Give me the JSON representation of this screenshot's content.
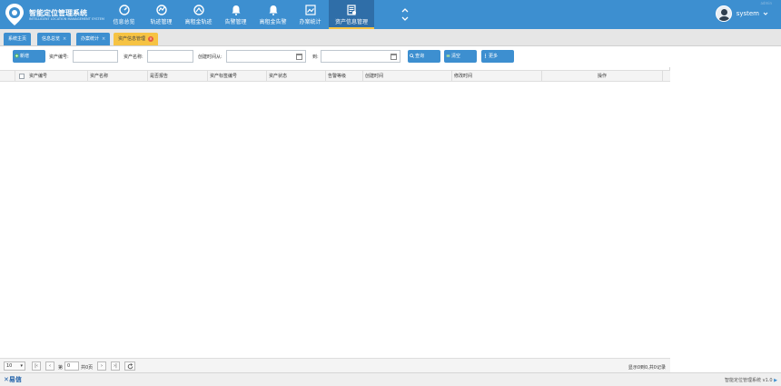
{
  "header": {
    "brand": "智能定位管理系统",
    "brand_sub": "INTELLIGENT LOCATION MANAGEMENT SYSTEM",
    "watermark": "admin",
    "nav": [
      {
        "label": "信息总览",
        "icon": "dashboard-icon"
      },
      {
        "label": "轨迹管理",
        "icon": "route-icon"
      },
      {
        "label": "高租金轨迹",
        "icon": "route-alt-icon"
      },
      {
        "label": "告警管理",
        "icon": "bell-icon"
      },
      {
        "label": "高租金告警",
        "icon": "bell-alt-icon"
      },
      {
        "label": "办案统计",
        "icon": "chart-icon"
      },
      {
        "label": "资产信息管理",
        "icon": "asset-icon",
        "active": true
      }
    ],
    "user": "system"
  },
  "tabs": [
    {
      "label": "系统主页"
    },
    {
      "label": "信息总览"
    },
    {
      "label": "办案统计"
    },
    {
      "label": "资产信息管理",
      "active": true
    }
  ],
  "toolbar": {
    "new_label": "新增",
    "asset_no_label": "资产编号:",
    "asset_name_label": "资产名称:",
    "created_label": "创建时间从:",
    "to_label": "到:",
    "search_label": "查询",
    "clear_label": "清空",
    "more_label": "更多"
  },
  "grid": {
    "columns": [
      "资产编号",
      "资产名称",
      "是否报告",
      "资产标签编号",
      "资产状态",
      "告警等级",
      "创建时间",
      "修改时间",
      "操作"
    ]
  },
  "pager": {
    "page_size": "10",
    "page_prefix": "第",
    "page_value": "0",
    "page_suffix": "共0页",
    "summary": "显示0到0,共0记录"
  },
  "footer": {
    "logo": "易信",
    "version": "智能定位管理系统 v1.0"
  },
  "colors": {
    "header": "#3d8fd0",
    "active_nav": "#2f6ea8",
    "active_tab": "#f6c343"
  }
}
